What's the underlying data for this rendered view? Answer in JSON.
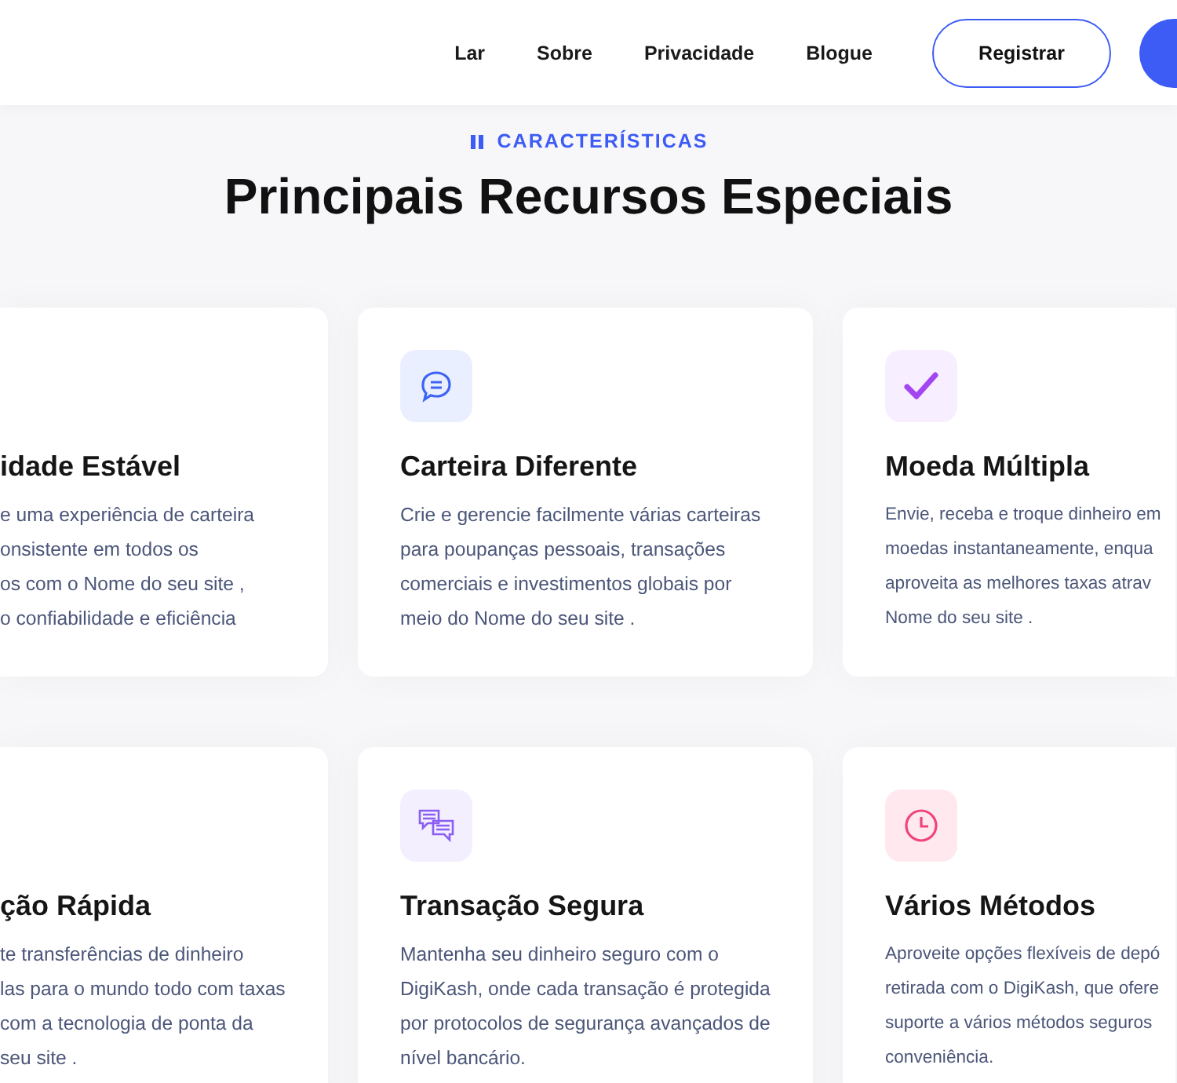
{
  "nav": {
    "links": [
      "Lar",
      "Sobre",
      "Privacidade",
      "Blogue"
    ],
    "register_button": "Registrar"
  },
  "section": {
    "eyebrow": "CARACTERÍSTICAS",
    "title": "Principais Recursos Especiais"
  },
  "features": [
    {
      "kind": "cut",
      "title": "idade Estável",
      "lines": [
        "e uma experiência de carteira",
        "onsistente em todos os",
        "os com o Nome do seu site ,",
        "o confiabilidade e eficiência"
      ]
    },
    {
      "kind": "chat",
      "title": "Carteira Diferente",
      "lines": [
        "Crie e gerencie facilmente várias carteiras",
        "para poupanças pessoais, transações",
        "comerciais e investimentos globais por",
        "meio do Nome do seu site ."
      ]
    },
    {
      "kind": "check",
      "title": "Moeda Múltipla",
      "lines": [
        "Envie, receba e troque dinheiro em",
        "moedas instantaneamente, enqua",
        "aproveita as melhores taxas atrav",
        "Nome do seu site ."
      ]
    },
    {
      "kind": "cut",
      "title": "ção Rápida",
      "lines": [
        "te transferências de dinheiro",
        "las para o mundo todo com taxas",
        "com a tecnologia de ponta da",
        "seu site ."
      ]
    },
    {
      "kind": "chats",
      "title": "Transação Segura",
      "lines": [
        "Mantenha seu dinheiro seguro com o",
        "DigiKash, onde cada transação é protegida",
        "por protocolos de segurança avançados de",
        "nível bancário."
      ]
    },
    {
      "kind": "clock",
      "title": "Vários Métodos",
      "lines": [
        "Aproveite opções flexíveis de depó",
        "retirada com o DigiKash, que ofere",
        "suporte a vários métodos seguros",
        "conveniência."
      ]
    }
  ]
}
